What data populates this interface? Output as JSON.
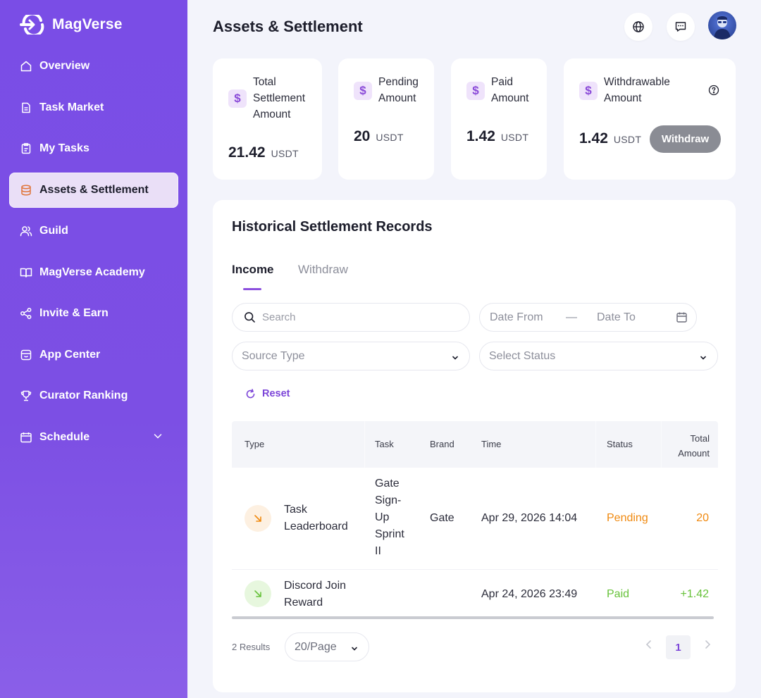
{
  "app": {
    "name": "MagVerse"
  },
  "sidebar": {
    "items": [
      {
        "label": "Overview",
        "icon": "home-icon"
      },
      {
        "label": "Task Market",
        "icon": "document-icon"
      },
      {
        "label": "My Tasks",
        "icon": "clipboard-icon"
      },
      {
        "label": "Assets & Settlement",
        "icon": "database-icon",
        "active": true
      },
      {
        "label": "Guild",
        "icon": "users-icon"
      },
      {
        "label": "MagVerse Academy",
        "icon": "book-icon"
      },
      {
        "label": "Invite & Earn",
        "icon": "share-icon"
      },
      {
        "label": "App Center",
        "icon": "store-icon"
      },
      {
        "label": "Curator Ranking",
        "icon": "trophy-icon"
      },
      {
        "label": "Schedule",
        "icon": "calendar-icon",
        "expandable": true
      }
    ]
  },
  "header": {
    "title": "Assets & Settlement"
  },
  "stats": {
    "total": {
      "label": "Total Settlement Amount",
      "value": "21.42",
      "unit": "USDT"
    },
    "pending": {
      "label": "Pending Amount",
      "value": "20",
      "unit": "USDT"
    },
    "paid": {
      "label": "Paid Amount",
      "value": "1.42",
      "unit": "USDT"
    },
    "withdrawable": {
      "label": "Withdrawable Amount",
      "value": "1.42",
      "unit": "USDT",
      "button": "Withdraw"
    }
  },
  "records": {
    "title": "Historical Settlement Records",
    "tabs": [
      "Income",
      "Withdraw"
    ],
    "filters": {
      "search_placeholder": "Search",
      "date_from": "Date From",
      "date_sep": "—",
      "date_to": "Date To",
      "source_type": "Source Type",
      "status": "Select Status",
      "reset": "Reset"
    },
    "columns": [
      "Type",
      "Task",
      "Brand",
      "Time",
      "Status",
      "Total Amount"
    ],
    "rows": [
      {
        "type": "Task Leaderboard",
        "task": "Gate Sign-Up Sprint II",
        "brand": "Gate",
        "time": "Apr 29, 2026 14:04",
        "status": "Pending",
        "amount": "20"
      },
      {
        "type": "Discord Join Reward",
        "task": "",
        "brand": "",
        "time": "Apr 24, 2026 23:49",
        "status": "Paid",
        "amount": "+1.42"
      }
    ],
    "footer": {
      "results": "2 Results",
      "page_size": "20/Page",
      "current_page": "1"
    }
  },
  "colors": {
    "brand": "#7a4de6",
    "accent": "#8c50de",
    "pending": "#f0890f",
    "paid": "#67c23a"
  }
}
